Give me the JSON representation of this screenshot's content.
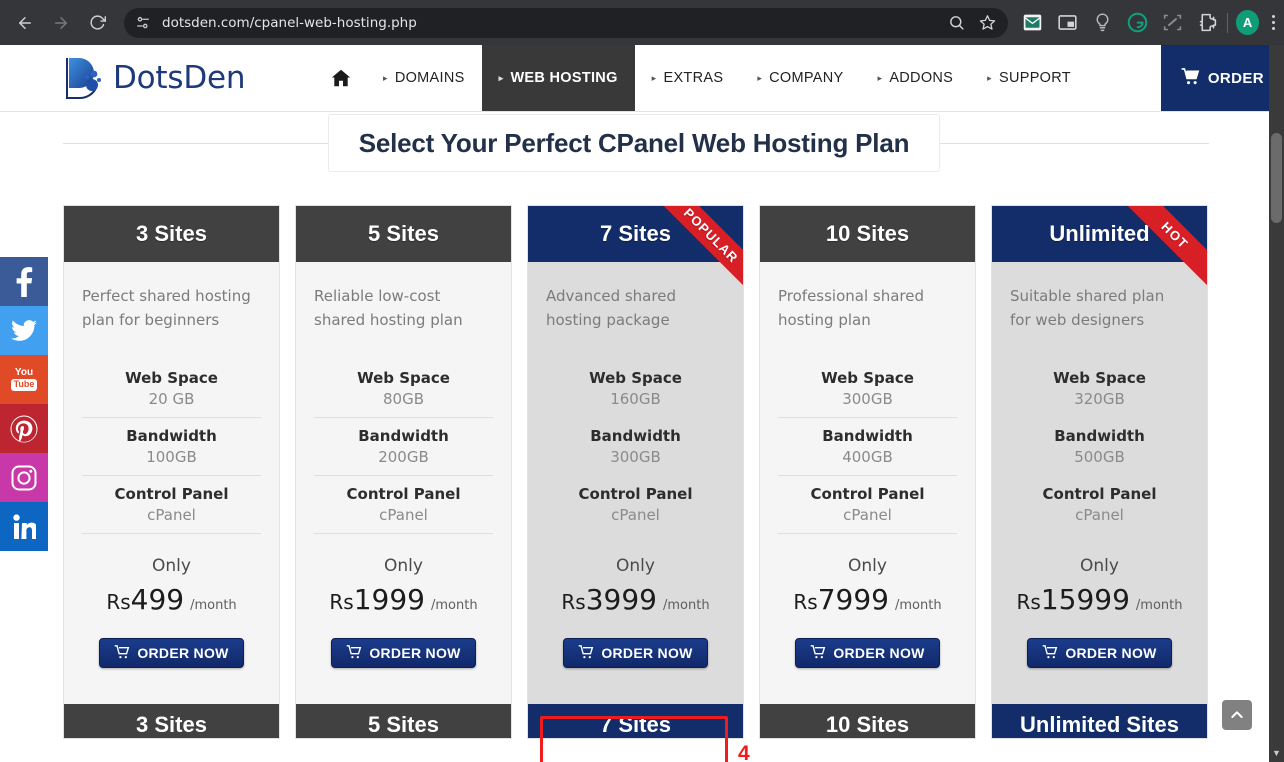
{
  "browser": {
    "url": "dotsden.com/cpanel-web-hosting.php",
    "back_label": "Back",
    "forward_label": "Forward",
    "reload_label": "Reload",
    "site_info_label": "site-settings-icon",
    "zoom_label": "zoom-icon",
    "bookmark_label": "bookmark-star-icon",
    "extensions": [
      "mail-extension-icon",
      "picture-in-picture-icon",
      "lightbulb-extension-icon",
      "grammarly-extension-icon",
      "capture-extension-icon",
      "puzzle-extensions-icon"
    ],
    "avatar_initial": "A",
    "menu_label": "chrome-menu"
  },
  "site": {
    "logo_text": "DotsDen",
    "nav": [
      {
        "label": "DOMAINS",
        "active": false
      },
      {
        "label": "WEB HOSTING",
        "active": true
      },
      {
        "label": "EXTRAS",
        "active": false
      },
      {
        "label": "COMPANY",
        "active": false
      },
      {
        "label": "ADDONS",
        "active": false
      },
      {
        "label": "SUPPORT",
        "active": false
      }
    ],
    "order_button": "ORDER",
    "home_icon": "home-icon"
  },
  "page": {
    "title": "Select Your Perfect CPanel Web Hosting Plan"
  },
  "labels": {
    "web_space": "Web Space",
    "bandwidth": "Bandwidth",
    "control_panel": "Control Panel",
    "only": "Only",
    "per_month": "/month",
    "currency": "Rs",
    "order_now": "ORDER NOW"
  },
  "plans": [
    {
      "name": "3 Sites",
      "desc": "Perfect shared hosting plan for beginners",
      "web_space": "20 GB",
      "bandwidth": "100GB",
      "control_panel": "cPanel",
      "price": "499",
      "featured": false,
      "ribbon": "",
      "next_name": "3 Sites"
    },
    {
      "name": "5 Sites",
      "desc": "Reliable low-cost shared hosting plan",
      "web_space": "80GB",
      "bandwidth": "200GB",
      "control_panel": "cPanel",
      "price": "1999",
      "featured": false,
      "ribbon": "",
      "next_name": "5 Sites"
    },
    {
      "name": "7 Sites",
      "desc": "Advanced shared hosting package",
      "web_space": "160GB",
      "bandwidth": "300GB",
      "control_panel": "cPanel",
      "price": "3999",
      "featured": true,
      "ribbon": "POPULAR",
      "next_name": "7 Sites"
    },
    {
      "name": "10 Sites",
      "desc": "Professional shared hosting plan",
      "web_space": "300GB",
      "bandwidth": "400GB",
      "control_panel": "cPanel",
      "price": "7999",
      "featured": false,
      "ribbon": "",
      "next_name": "10 Sites"
    },
    {
      "name": "Unlimited",
      "desc": "Suitable shared plan for web designers",
      "web_space": "320GB",
      "bandwidth": "500GB",
      "control_panel": "cPanel",
      "price": "15999",
      "featured": true,
      "ribbon": "HOT",
      "next_name": "Unlimited Sites"
    }
  ],
  "annotation": {
    "number": "4",
    "color": "#ee1c1c",
    "target": "order-now-button-7-sites"
  },
  "social": [
    {
      "name": "facebook",
      "glyph": "f"
    },
    {
      "name": "twitter",
      "glyph": ""
    },
    {
      "name": "youtube",
      "glyph": "You"
    },
    {
      "name": "youtube_badge",
      "glyph": "Tube"
    },
    {
      "name": "pinterest",
      "glyph": ""
    },
    {
      "name": "instagram",
      "glyph": ""
    },
    {
      "name": "linkedin",
      "glyph": "in"
    }
  ],
  "scroll_top_label": "scroll-to-top"
}
